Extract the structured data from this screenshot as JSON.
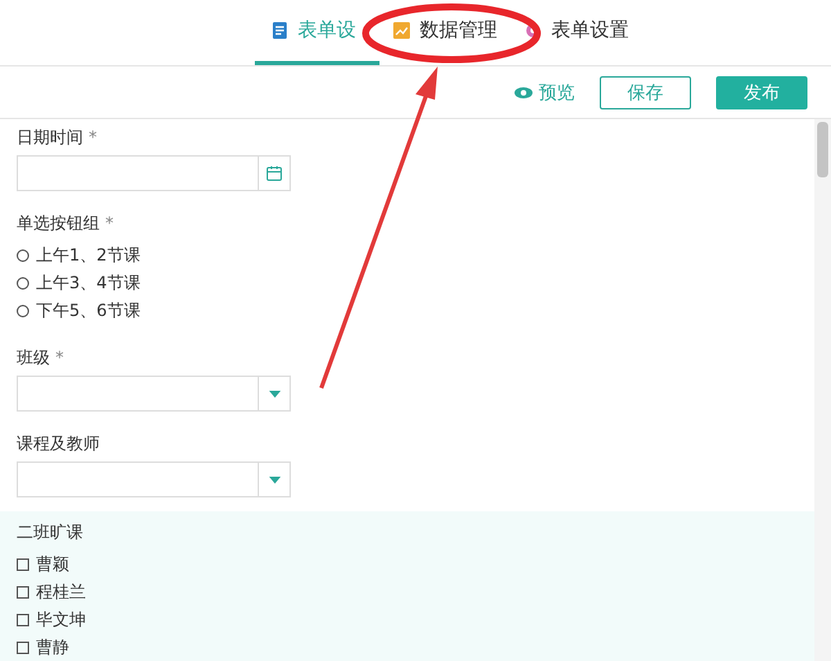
{
  "tabs": [
    {
      "label": "表单设",
      "selected": true
    },
    {
      "label": "数据管理",
      "selected": false
    },
    {
      "label": "表单设置",
      "selected": false
    }
  ],
  "toolbar": {
    "preview": "预览",
    "save": "保存",
    "publish": "发布"
  },
  "fields": [
    {
      "kind": "date",
      "label": "日期时间",
      "required_mark": "*"
    },
    {
      "kind": "radio",
      "label": "单选按钮组",
      "required_mark": "*",
      "options": [
        {
          "label": "上午1、2节课",
          "selected": false
        },
        {
          "label": "上午3、4节课",
          "selected": false
        },
        {
          "label": "下午5、6节课",
          "selected": false
        }
      ]
    },
    {
      "kind": "select",
      "label": "班级",
      "required_mark": "*"
    },
    {
      "kind": "select",
      "label": "课程及教师"
    },
    {
      "kind": "checkbox",
      "label": "二班旷课",
      "options": [
        {
          "label": "曹颖",
          "checked": false
        },
        {
          "label": "程桂兰",
          "checked": false
        },
        {
          "label": "毕文坤",
          "checked": false
        },
        {
          "label": "曹静",
          "checked": false
        }
      ]
    }
  ]
}
